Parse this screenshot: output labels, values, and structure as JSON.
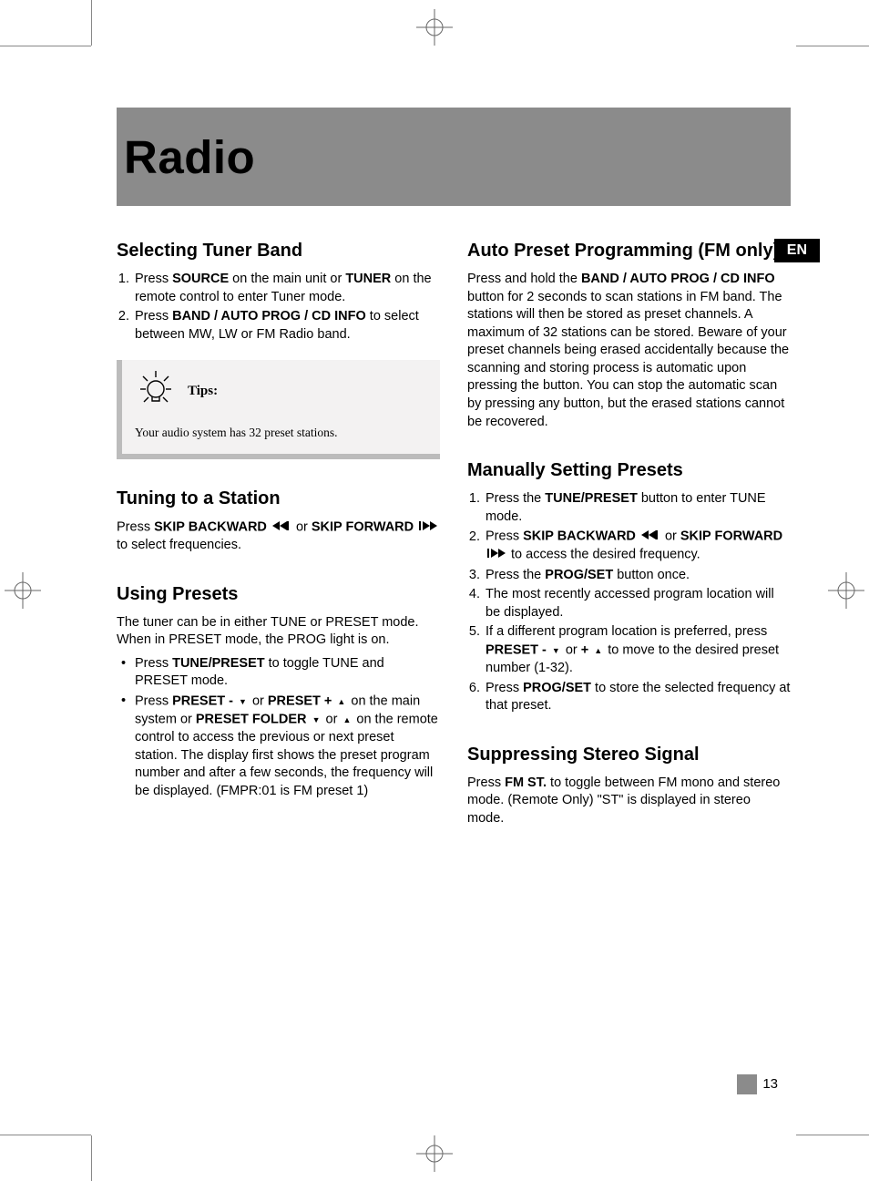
{
  "banner": {
    "title": "Radio"
  },
  "lang": "EN",
  "page_number": "13",
  "left": {
    "selecting": {
      "heading": "Selecting Tuner Band",
      "step1_pre": "Press ",
      "step1_b1": "SOURCE",
      "step1_mid": " on the main unit or ",
      "step1_b2": "TUNER",
      "step1_post": " on the remote control to enter Tuner mode.",
      "step2_pre": "Press ",
      "step2_b1": "BAND / AUTO PROG / CD INFO",
      "step2_post": " to select between MW, LW  or FM Radio band."
    },
    "tips": {
      "label": "Tips:",
      "text": "Your audio system has 32 preset stations."
    },
    "tuning": {
      "heading": "Tuning to a Station",
      "pre": "Press ",
      "b1": "SKIP BACKWARD",
      "mid": " or ",
      "b2": "SKIP FORWARD",
      "post": " to select frequencies."
    },
    "using": {
      "heading": "Using Presets",
      "intro": "The tuner can be in either TUNE or PRESET mode. When in PRESET mode, the PROG light is on.",
      "b1_pre": "Press ",
      "b1_bold": "TUNE/PRESET",
      "b1_post": " to toggle TUNE and PRESET mode.",
      "b2_pre": "Press ",
      "b2_bold1": "PRESET -",
      "b2_mid1": "  or ",
      "b2_bold2": "PRESET +",
      "b2_mid2": "  on the main system or ",
      "b2_bold3": "PRESET FOLDER",
      "b2_mid3": " or ",
      "b2_post": " on the remote control to access the previous or next preset station. The display first shows the preset program number and after a few seconds, the frequency  will be displayed. (FMPR:01 is FM preset 1)"
    }
  },
  "right": {
    "auto": {
      "heading": "Auto Preset Programming (FM only)",
      "pre": "Press and hold the ",
      "b1": "BAND / AUTO PROG / CD INFO",
      "post": " button for 2 seconds to scan stations in FM band. The stations will then be stored as preset channels. A maximum of 32 stations can be stored. Beware of your preset channels being erased accidentally because the scanning and storing process is automatic upon pressing the button. You can stop the automatic scan by pressing any button, but the erased stations cannot be recovered."
    },
    "manual": {
      "heading": "Manually Setting Presets",
      "s1_pre": "Press the ",
      "s1_b": "TUNE/PRESET",
      "s1_post": " button to enter TUNE mode.",
      "s2_pre": "Press ",
      "s2_b1": "SKIP BACKWARD",
      "s2_mid": " or ",
      "s2_b2": "SKIP FORWARD",
      "s2_post": " to access the desired frequency.",
      "s3_pre": "Press the ",
      "s3_b": "PROG/SET",
      "s3_post": " button once.",
      "s4": "The most recently accessed program location will be displayed.",
      "s5_pre": "If a different program location is preferred, press ",
      "s5_b1": "PRESET  -",
      "s5_mid": "  or ",
      "s5_b2": "+",
      "s5_post": " to move to the desired preset number (1-32).",
      "s6_pre": "Press ",
      "s6_b": "PROG/SET",
      "s6_post": " to store the selected frequency at that preset."
    },
    "suppress": {
      "heading": "Suppressing Stereo Signal",
      "pre": "Press ",
      "b1": "FM ST.",
      "post": " to toggle between FM mono and stereo mode. (Remote Only) \"ST\" is displayed in stereo mode."
    }
  }
}
